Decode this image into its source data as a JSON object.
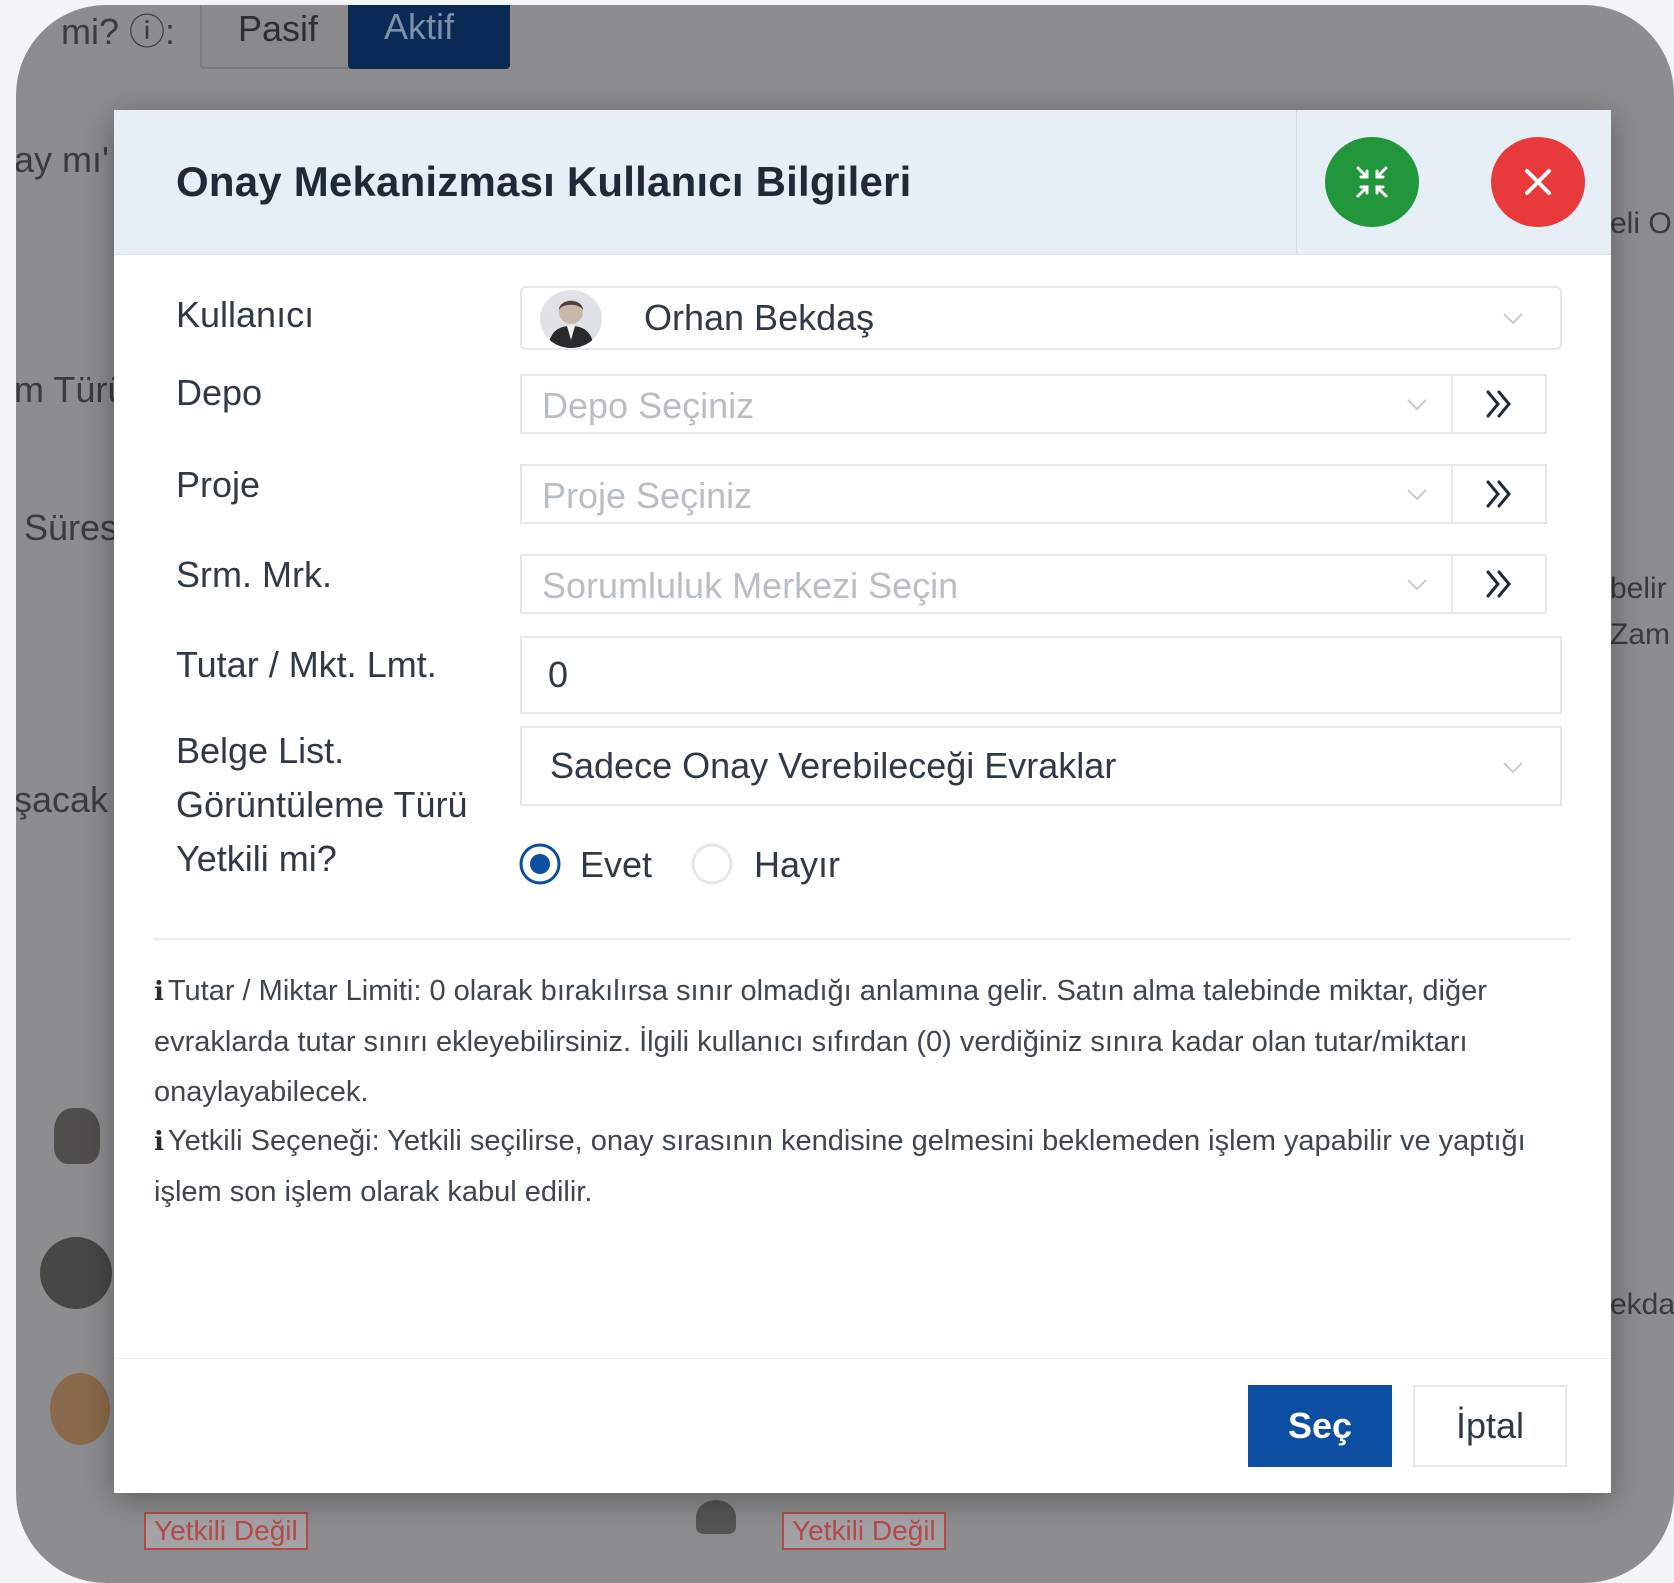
{
  "background": {
    "toggle": {
      "pasif_label": "Pasif",
      "aktif_label": "Aktif"
    },
    "fragments": {
      "top_question": "mi? ⓘ:",
      "onay_mi": "ay mı'",
      "form_turu": "m Türü",
      "suresi": "Süres",
      "ulasacak": "şacak",
      "right_1": "eli O",
      "right_2": "belir",
      "right_3": "Zam",
      "right_4": "ekda"
    },
    "badges": [
      "Yetkili Değil",
      "Yetkili Değil"
    ]
  },
  "modal": {
    "title": "Onay Mekanizması Kullanıcı Bilgileri",
    "fields": {
      "kullanici": {
        "label": "Kullanıcı",
        "value": "Orhan Bekdaş"
      },
      "depo": {
        "label": "Depo",
        "placeholder": "Depo Seçiniz"
      },
      "proje": {
        "label": "Proje",
        "placeholder": "Proje Seçiniz"
      },
      "srm_mrk": {
        "label": "Srm. Mrk.",
        "placeholder": "Sorumluluk Merkezi Seçin"
      },
      "tutar": {
        "label": "Tutar / Mkt. Lmt.",
        "value": "0"
      },
      "belge": {
        "label_line1": "Belge List.",
        "label_line2": "Görüntüleme Türü",
        "value": "Sadece Onay Verebileceği Evraklar"
      },
      "yetkili": {
        "label": "Yetkili mi?",
        "options": [
          "Evet",
          "Hayır"
        ],
        "selected": "Evet"
      }
    },
    "notes": {
      "tutar_note": "Tutar / Miktar Limiti: 0 olarak bırakılırsa sınır olmadığı anlamına gelir. Satın alma talebinde miktar, diğer evraklarda tutar sınırı ekleyebilirsiniz. İlgili kullanıcı sıfırdan (0) verdiğiniz sınıra kadar olan tutar/miktarı onaylayabilecek.",
      "yetkili_note": "Yetkili Seçeneği: Yetkili seçilirse, onay sırasının kendisine gelmesini beklemeden işlem yapabilir ve yaptığı işlem son işlem olarak kabul edilir."
    },
    "info_icon_glyph": "i",
    "buttons": {
      "select": "Seç",
      "cancel": "İptal"
    }
  },
  "colors": {
    "primary": "#0b4ea2",
    "minimize": "#22963a",
    "close": "#e83a3a",
    "header_bg": "#e6eef6",
    "overlay": "#8d8d8f",
    "badge": "#b44a4a"
  },
  "icons": [
    "expand-arrows-icon",
    "close-icon",
    "chevron-down-icon",
    "double-chevron-right-icon",
    "radio-checked-icon",
    "radio-unchecked-icon",
    "info-icon",
    "avatar"
  ]
}
